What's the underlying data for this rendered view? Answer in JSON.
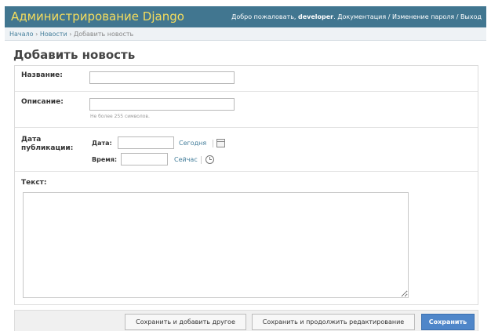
{
  "header": {
    "title": "Администрирование Django",
    "welcome": "Добро пожаловать,",
    "username": "developer",
    "docs_link": "Документация",
    "separator": "/",
    "password_link": "Изменение пароля",
    "logout_link": "Выход"
  },
  "breadcrumbs": {
    "home": "Начало",
    "section": "Новости",
    "current": "Добавить новость",
    "separator": "›"
  },
  "page_title": "Добавить новость",
  "form": {
    "title_label": "Название:",
    "title_value": "",
    "description_label": "Описание:",
    "description_value": "",
    "description_help": "Не более 255 символов.",
    "pub_label": "Дата публикации:",
    "date_label": "Дата:",
    "date_value": "",
    "today_link": "Сегодня",
    "time_label": "Время:",
    "time_value": "",
    "now_link": "Сейчас",
    "text_label": "Текст:",
    "text_value": ""
  },
  "submit": {
    "save_add_another": "Сохранить и добавить другое",
    "save_continue": "Сохранить и продолжить редактирование",
    "save": "Сохранить"
  },
  "colors": {
    "header_bg": "#417690",
    "title_color": "#f5dd5d",
    "link_color": "#447e9b",
    "primary_button": "#4f86c9"
  }
}
